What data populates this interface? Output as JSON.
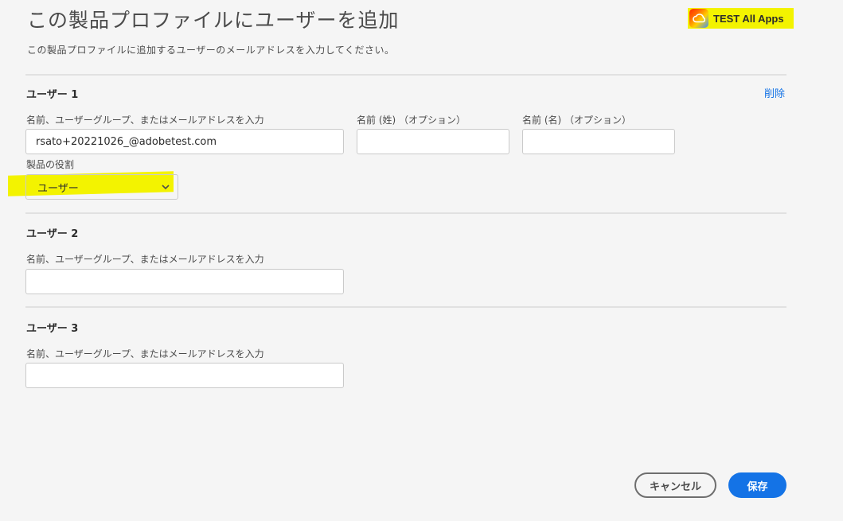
{
  "dialog": {
    "title": "この製品プロファイルにユーザーを追加",
    "subtitle": "この製品プロファイルに追加するユーザーのメールアドレスを入力してください。",
    "product_name": "TEST All Apps",
    "product_icon": "creative-cloud-icon"
  },
  "users": [
    {
      "heading": "ユーザー 1",
      "remove_label": "削除",
      "email_label": "名前、ユーザーグループ、またはメールアドレスを入力",
      "email_value": "rsato+20221026_@adobetest.com",
      "last_name_label": "名前 (姓) （オプション）",
      "last_name_value": "",
      "first_name_label": "名前 (名) （オプション）",
      "first_name_value": "",
      "role_label": "製品の役割",
      "role_value": "ユーザー"
    },
    {
      "heading": "ユーザー 2",
      "email_label": "名前、ユーザーグループ、またはメールアドレスを入力",
      "email_value": ""
    },
    {
      "heading": "ユーザー 3",
      "email_label": "名前、ユーザーグループ、またはメールアドレスを入力",
      "email_value": ""
    }
  ],
  "footer": {
    "cancel_label": "キャンセル",
    "save_label": "保存"
  },
  "colors": {
    "accent": "#1473e6",
    "highlight": "#f3f300",
    "background": "#f5f5f5"
  }
}
